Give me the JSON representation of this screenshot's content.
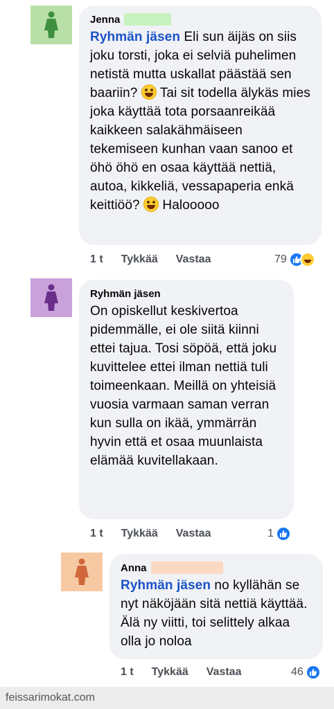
{
  "comments": [
    {
      "author": "Jenna",
      "mention": "Ryhmän jäsen",
      "text_before": " Eli sun äijäs on siis joku torsti, joka ei selviä puhelimen netistä mutta uskallat päästää sen baariin? ",
      "text_middle": " Tai sit todella älykäs mies joka käyttää tota porsaanreikää kaikkeen salakähmäiseen tekemiseen kunhan vaan sanoo et öhö öhö en osaa käyttää nettiä, autoa, kikkeliä, vessapaperia enkä keittiöö? ",
      "text_after": " Halooooo",
      "emoji": "laughing-tears-emoji",
      "time": "1 t",
      "like": "Tykkää",
      "reply": "Vastaa",
      "reactions": "79",
      "avatar_color": "#b9dfa8",
      "figure_color": "#3e8f3e"
    },
    {
      "author": "Ryhmän jäsen",
      "text": "On opiskellut keskivertoa pidemmälle, ei ole siitä kiinni ettei tajua. Tosi söpöä, että joku kuvittelee ettei ilman nettiä tuli toimeenkaan. Meillä on yhteisiä vuosia varmaan saman verran kun sulla on ikää, ymmärrän hyvin että et osaa muunlaista elämää kuvitellakaan.",
      "time": "1 t",
      "like": "Tykkää",
      "reply": "Vastaa",
      "reactions": "1",
      "avatar_color": "#c9a2dc",
      "figure_color": "#6a2f8a"
    },
    {
      "author": "Anna",
      "mention": "Ryhmän jäsen",
      "text": " no kyllähän se nyt näköjään sitä nettiä käyttää. Älä ny viitti, toi selittely alkaa olla jo noloa",
      "time": "1 t",
      "like": "Tykkää",
      "reply": "Vastaa",
      "reactions": "46",
      "avatar_color": "#f6c9a3",
      "figure_color": "#d0683c"
    }
  ],
  "footer": "feissarimokat.com",
  "colors": {
    "accent": "#1877f2",
    "mention": "#1a52c7",
    "bubble": "#f0f2f5",
    "redact_green": "#c8f2c0",
    "redact_peach": "#fbd9c2"
  }
}
